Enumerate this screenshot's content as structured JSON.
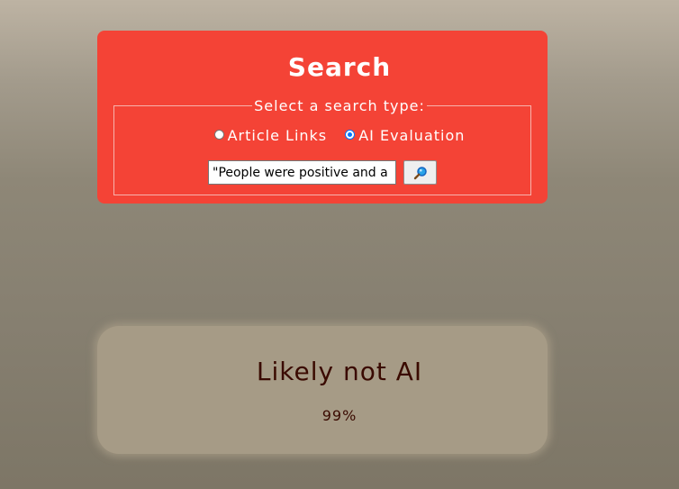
{
  "search": {
    "title": "Search",
    "type_legend": "Select a search type:",
    "options": [
      {
        "label": "Article Links",
        "checked": false
      },
      {
        "label": "AI Evaluation",
        "checked": true
      }
    ],
    "input_value": "\"People were positive and a",
    "button_icon": "magnifying-glass-icon",
    "accent_color": "#f44336"
  },
  "result": {
    "verdict": "Likely not AI",
    "score": "99%"
  }
}
